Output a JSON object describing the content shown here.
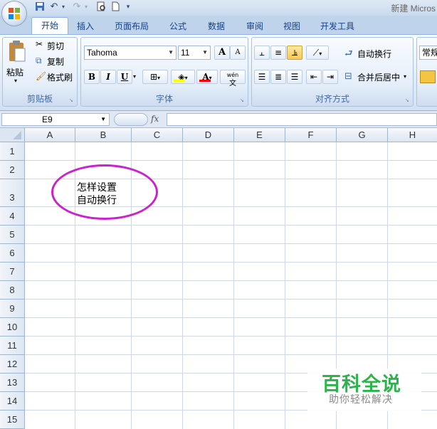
{
  "window": {
    "title": "新建 Micros"
  },
  "quick_access": {
    "icons": [
      "save-icon",
      "undo-icon",
      "redo-icon",
      "print-preview-icon",
      "new-doc-icon",
      "customize-qat-icon"
    ]
  },
  "tabs": [
    "开始",
    "插入",
    "页面布局",
    "公式",
    "数据",
    "审阅",
    "视图",
    "开发工具"
  ],
  "clipboard": {
    "paste_label": "粘贴",
    "cut_label": "剪切",
    "copy_label": "复制",
    "format_painter_label": "格式刷",
    "group_label": "剪贴板"
  },
  "font": {
    "name": "Tahoma",
    "size": "11",
    "grow_label": "A",
    "shrink_label": "A",
    "bold_label": "B",
    "italic_label": "I",
    "underline_label": "U",
    "font_color_label": "A",
    "phonetic_label": "wén",
    "phonetic_char": "文",
    "group_label": "字体",
    "highlight_color": "#ffff00",
    "text_color": "#ff0000"
  },
  "alignment": {
    "wrap_text_label": "自动换行",
    "merge_center_label": "合并后居中",
    "group_label": "对齐方式"
  },
  "number": {
    "format_label": "常规"
  },
  "formula_bar": {
    "cell_ref": "E9",
    "fx_label": "fx",
    "value": ""
  },
  "grid": {
    "columns": [
      "A",
      "B",
      "C",
      "D",
      "E",
      "F",
      "G",
      "H"
    ],
    "rows": [
      "1",
      "2",
      "3",
      "4",
      "5",
      "6",
      "7",
      "8",
      "9",
      "10",
      "11",
      "12",
      "13",
      "14",
      "15"
    ],
    "cell_B3_line1": "怎样设置",
    "cell_B3_line2": "自动换行",
    "annotation_color": "#cc22cc"
  },
  "watermark": {
    "main": "百科全说",
    "sub": "助你轻松解决"
  }
}
